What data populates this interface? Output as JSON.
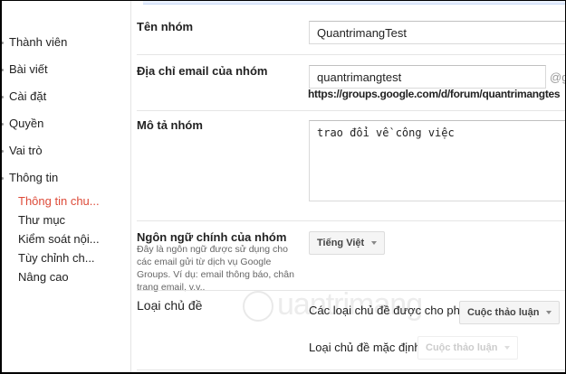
{
  "sidebar": {
    "items": [
      {
        "label": "Thành viên"
      },
      {
        "label": "Bài viết"
      },
      {
        "label": "Cài đặt"
      },
      {
        "label": "Quyền"
      },
      {
        "label": "Vai trò"
      },
      {
        "label": "Thông tin"
      }
    ],
    "subitems": [
      {
        "label": "Thông tin chu..."
      },
      {
        "label": "Thư mục"
      },
      {
        "label": "Kiểm soát nội..."
      },
      {
        "label": "Tùy chỉnh ch..."
      },
      {
        "label": "Nâng cao"
      }
    ]
  },
  "form": {
    "name_label": "Tên nhóm",
    "name_value": "QuantrimangTest",
    "email_label": "Địa chỉ email của nhóm",
    "email_value": "quantrimangtest",
    "email_domain": "@g",
    "url": "https://groups.google.com/d/forum/quantrimangtes",
    "desc_label": "Mô tả nhóm",
    "desc_value": "trao đổi về công việc",
    "lang_label": "Ngôn ngữ chính của nhóm",
    "lang_desc": "Đây là ngôn ngữ được sử dụng cho các email gửi từ dịch vụ Google Groups. Ví dụ: email thông báo, chân trang email, v.v..",
    "lang_value": "Tiếng Việt",
    "topic_label": "Loại chủ đề",
    "allowed_label": "Các loại chủ đề được cho phép",
    "allowed_value": "Cuộc thảo luận",
    "default_label": "Loại chủ đề mặc định",
    "default_value": "Cuộc thảo luận"
  },
  "watermark": "uantrimang"
}
